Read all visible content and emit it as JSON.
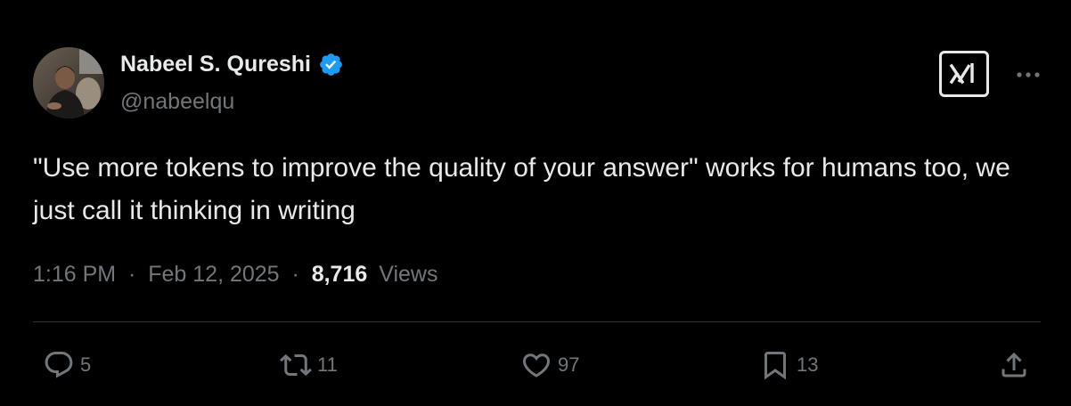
{
  "author": {
    "name": "Nabeel S. Qureshi",
    "handle": "@nabeelqu",
    "verified_color": "#1d9bf0"
  },
  "header_icons": {
    "badge": "xai-logo-icon",
    "menu": "more-options-icon"
  },
  "tweet": {
    "text": "\"Use more tokens to improve the quality of your answer\" works for humans too, we just call it thinking in writing"
  },
  "meta": {
    "time": "1:16 PM",
    "separator": "·",
    "date": "Feb 12, 2025",
    "views_count": "8,716",
    "views_label": "Views"
  },
  "actions": {
    "replies": "5",
    "reposts": "11",
    "likes": "97",
    "bookmarks": "13"
  },
  "colors": {
    "background": "#000000",
    "text_primary": "#e7e9ea",
    "text_secondary": "#71767b",
    "divider": "#2f3336"
  }
}
